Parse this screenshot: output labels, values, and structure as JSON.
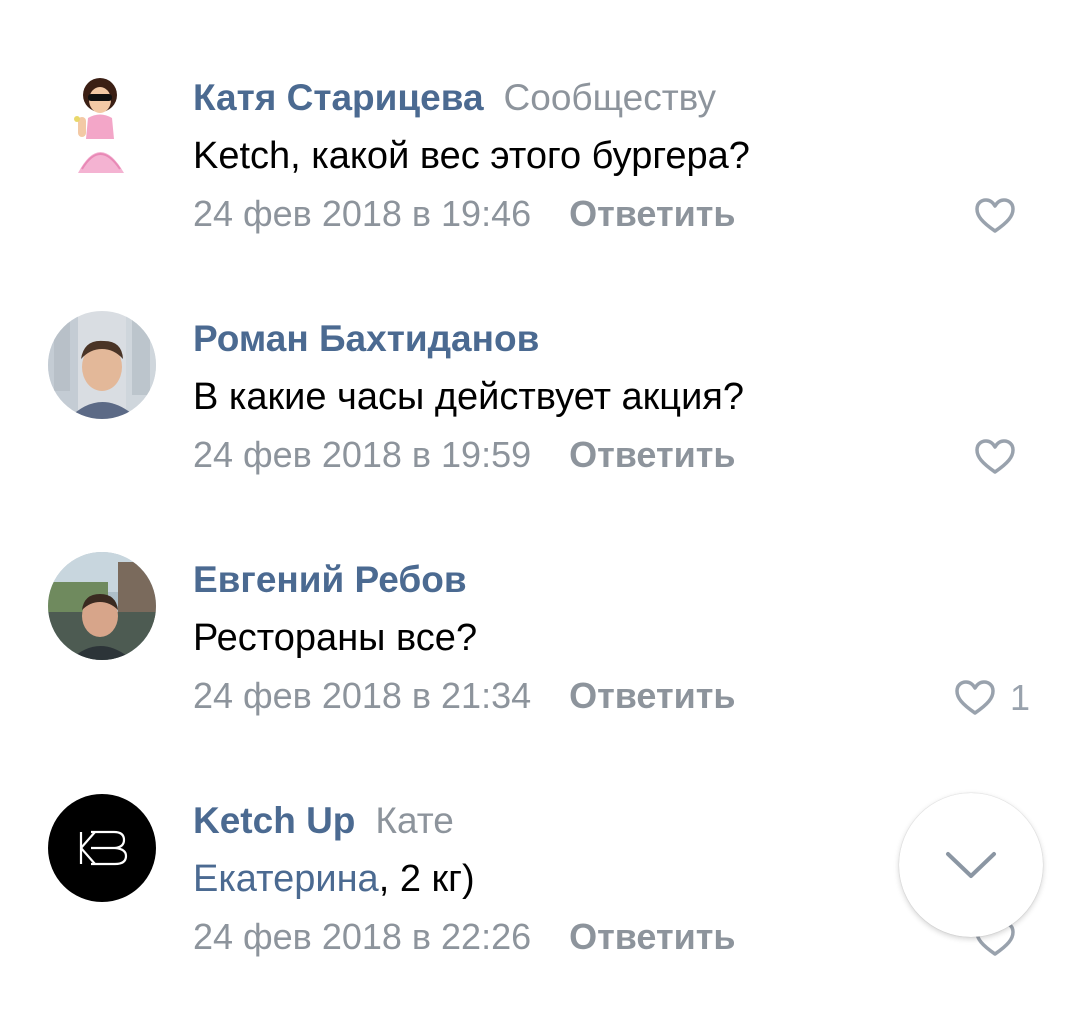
{
  "comments": [
    {
      "author": "Катя Старицева",
      "reply_to": "Сообществу",
      "mention": "",
      "text": "Ketch, какой вес этого бургера?",
      "date": "24 фев 2018 в 19:46",
      "reply_label": "Ответить",
      "likes": ""
    },
    {
      "author": "Роман Бахтиданов",
      "reply_to": "",
      "mention": "",
      "text": "В какие часы действует акция?",
      "date": "24 фев 2018 в 19:59",
      "reply_label": "Ответить",
      "likes": ""
    },
    {
      "author": "Евгений Ребов",
      "reply_to": "",
      "mention": "",
      "text": "Рестораны все?",
      "date": "24 фев 2018 в 21:34",
      "reply_label": "Ответить",
      "likes": "1"
    },
    {
      "author": "Ketch Up",
      "reply_to": "Кате",
      "mention": "Екатерина",
      "text": ", 2 кг)",
      "date": "24 фев 2018 в 22:26",
      "reply_label": "Ответить",
      "likes": ""
    }
  ],
  "icons": {
    "like": "heart-outline-icon",
    "scroll": "chevron-down-icon",
    "ketchup_logo": "kb-monogram-logo"
  },
  "colors": {
    "author": "#4b6a91",
    "meta": "#8d949c",
    "text": "#000000",
    "icon": "#99a2ad"
  }
}
